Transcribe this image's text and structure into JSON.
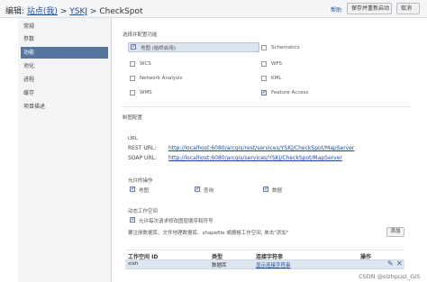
{
  "header": {
    "breadcrumb_prefix": "编辑:",
    "breadcrumb_site": "站点(我)",
    "sep1": ">",
    "breadcrumb_folder": "YSKJ",
    "sep2": ">",
    "breadcrumb_service": "CheckSpot",
    "help": "帮助",
    "save_restart": "保存并重新启动",
    "cancel": "取消"
  },
  "sidebar": {
    "items": [
      {
        "label": "常规"
      },
      {
        "label": "参数"
      },
      {
        "label": "功能"
      },
      {
        "label": "池化"
      },
      {
        "label": "进程"
      },
      {
        "label": "缓存"
      },
      {
        "label": "项目描述"
      }
    ]
  },
  "capabilities": {
    "title": "选择并配置功能",
    "items": [
      {
        "label": "地图 (始终启用)",
        "checked": true
      },
      {
        "label": "Schematics",
        "checked": false
      },
      {
        "label": "WCS",
        "checked": false
      },
      {
        "label": "WFS",
        "checked": false
      },
      {
        "label": "Network Analysis",
        "checked": false
      },
      {
        "label": "KML",
        "checked": false
      },
      {
        "label": "WMS",
        "checked": false
      },
      {
        "label": "Feature Access",
        "checked": true
      }
    ]
  },
  "map_config": {
    "title": "制图配置",
    "url_title": "URL",
    "rest_label": "REST URL:",
    "rest_url": "http://localhost:6080/arcgis/rest/services/YSKJ/CheckSpot/MapServer",
    "soap_label": "SOAP URL:",
    "soap_url": "http://localhost:6080/arcgis/services/YSKJ/CheckSpot/MapServer"
  },
  "operations": {
    "title": "允许的操作",
    "items": [
      {
        "label": "地图",
        "checked": true
      },
      {
        "label": "查询",
        "checked": true
      },
      {
        "label": "数据",
        "checked": true
      }
    ]
  },
  "dynamic_workspace": {
    "title": "动态工作空间",
    "checkbox_label": "允许每次请求修改图层顺序和符号",
    "checked": true,
    "description": "要注册数据库、文件地理数据库、shapefile 或栅格工作空间, 单击\"添加\"",
    "add_button": "添加"
  },
  "table": {
    "headers": [
      "工作空间 ID",
      "类型",
      "连接字符串",
      "操作"
    ],
    "rows": [
      {
        "id": "xixh",
        "type": "数据库",
        "conn": "显示连接字符串"
      }
    ]
  },
  "watermark": "CSDN @sizhpust_GIS"
}
